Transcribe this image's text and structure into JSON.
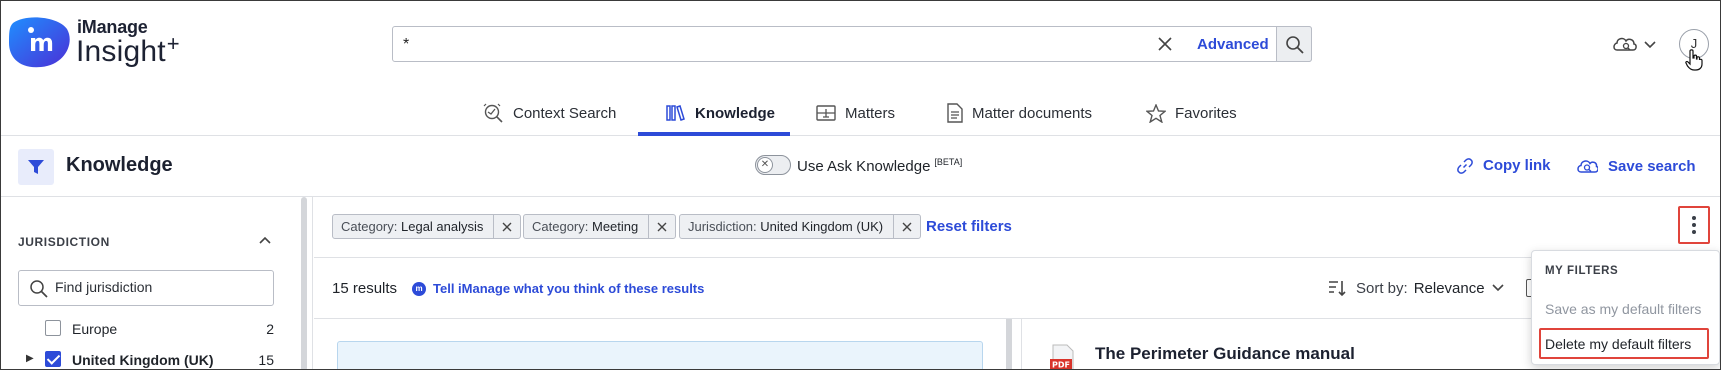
{
  "app": {
    "brand_top": "iManage",
    "brand_main": "Insight",
    "brand_plus": "+",
    "logo_glyph": "m"
  },
  "search": {
    "value": "*",
    "advanced_label": "Advanced"
  },
  "header": {
    "avatar_initial": "J"
  },
  "tabs": [
    {
      "label": "Context Search",
      "icon": "context-search-icon",
      "active": false
    },
    {
      "label": "Knowledge",
      "icon": "books-icon",
      "active": true
    },
    {
      "label": "Matters",
      "icon": "matters-icon",
      "active": false
    },
    {
      "label": "Matter documents",
      "icon": "document-icon",
      "active": false
    },
    {
      "label": "Favorites",
      "icon": "star-icon",
      "active": false
    }
  ],
  "page": {
    "title": "Knowledge",
    "toggle_label": "Use Ask Knowledge",
    "toggle_beta": "[BETA]",
    "toggle_knob_glyph": "✕",
    "copy_link": "Copy link",
    "save_search": "Save search"
  },
  "sidebar": {
    "facet_title": "JURISDICTION",
    "search_placeholder": "Find jurisdiction",
    "items": [
      {
        "label": "Europe",
        "count": "2",
        "checked": false
      },
      {
        "label": "United Kingdom (UK)",
        "count": "15",
        "checked": true
      }
    ]
  },
  "filters": {
    "chips": [
      {
        "key": "Category:",
        "value": "Legal analysis"
      },
      {
        "key": "Category:",
        "value": "Meeting"
      },
      {
        "key": "Jurisdiction:",
        "value": "United Kingdom (UK)"
      }
    ],
    "reset_label": "Reset filters"
  },
  "results": {
    "count_label": "15 results",
    "feedback_label": "Tell iManage what you think of these results",
    "sort_label": "Sort by:",
    "sort_value": "Relevance",
    "first_doc_title": "The Perimeter Guidance manual",
    "first_doc_badge": "PDF"
  },
  "menu": {
    "heading": "MY FILTERS",
    "items": [
      {
        "label": "Save as my default filters",
        "enabled": false
      },
      {
        "label": "Delete my default filters",
        "enabled": true
      }
    ]
  },
  "colors": {
    "accent": "#2d4bd8",
    "highlight": "#e0443b",
    "logo_blue": "#3b5cf0"
  }
}
